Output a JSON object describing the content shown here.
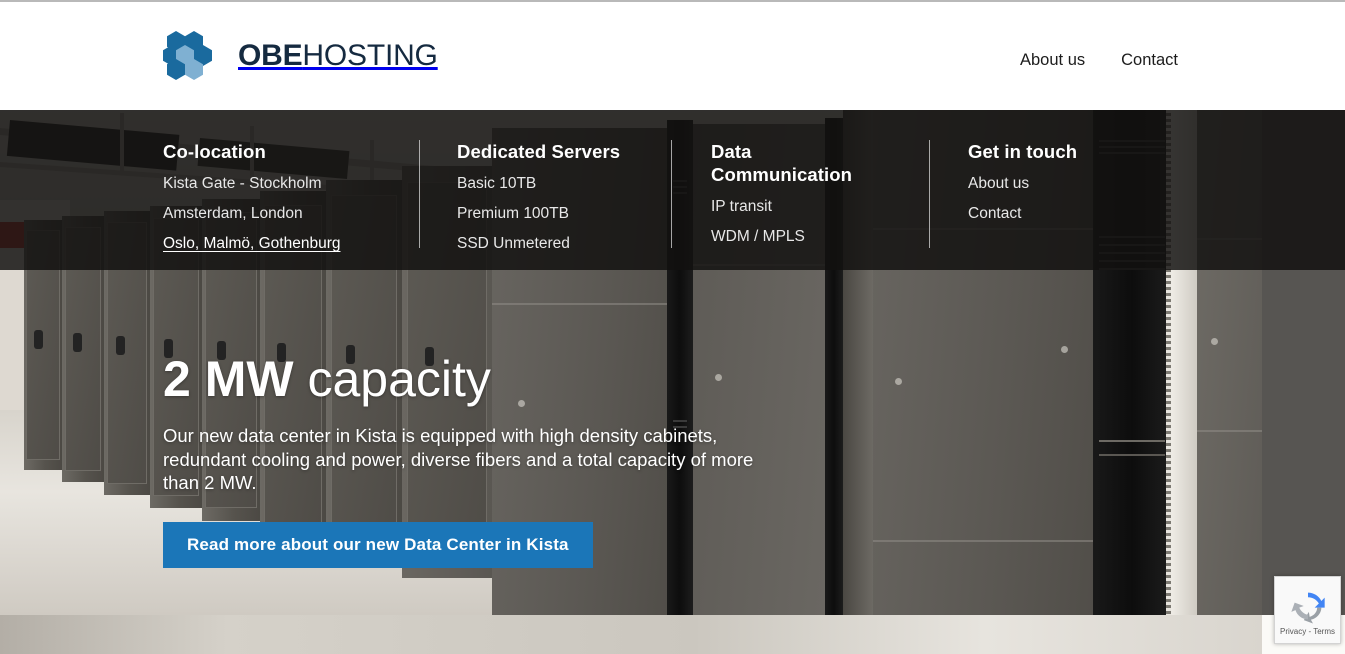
{
  "brand": {
    "logo_icon": "hexagon-cluster-logo",
    "name_bold": "OBE",
    "name_light": "HOSTING",
    "color_dark": "#152a40",
    "color_hex_dark": "#1a6a9e",
    "color_hex_light": "#7fb0d2"
  },
  "header": {
    "nav": [
      {
        "label": "About us"
      },
      {
        "label": "Contact"
      }
    ]
  },
  "megamenu": {
    "columns": [
      {
        "title": "Co-location",
        "items": [
          {
            "label": "Kista Gate - Stockholm",
            "hovered": false
          },
          {
            "label": "Amsterdam, London",
            "hovered": false
          },
          {
            "label": "Oslo, Malmö, Gothenburg",
            "hovered": true
          }
        ]
      },
      {
        "title": "Dedicated Servers",
        "items": [
          {
            "label": "Basic 10TB",
            "hovered": false
          },
          {
            "label": "Premium 100TB",
            "hovered": false
          },
          {
            "label": "SSD Unmetered",
            "hovered": false
          }
        ]
      },
      {
        "title": "Data Communication",
        "items": [
          {
            "label": "IP transit",
            "hovered": false
          },
          {
            "label": "WDM / MPLS",
            "hovered": false
          }
        ]
      },
      {
        "title": "Get in touch",
        "items": [
          {
            "label": "About us",
            "hovered": false
          },
          {
            "label": "Contact",
            "hovered": false
          }
        ]
      }
    ]
  },
  "hero": {
    "title_strong": "2 MW",
    "title_light": "capacity",
    "paragraph": "Our new data center in Kista is equipped with high density cabinets, redundant cooling and power, diverse fibers and a total capacity of more than 2 MW.",
    "cta_label": "Read more about our new Data Center in Kista",
    "cta_color": "#1b76b8",
    "image_alt": "data-center-server-racks-photo"
  },
  "recaptcha": {
    "icon": "recaptcha-logo-icon",
    "terms": "Privacy - Terms"
  }
}
